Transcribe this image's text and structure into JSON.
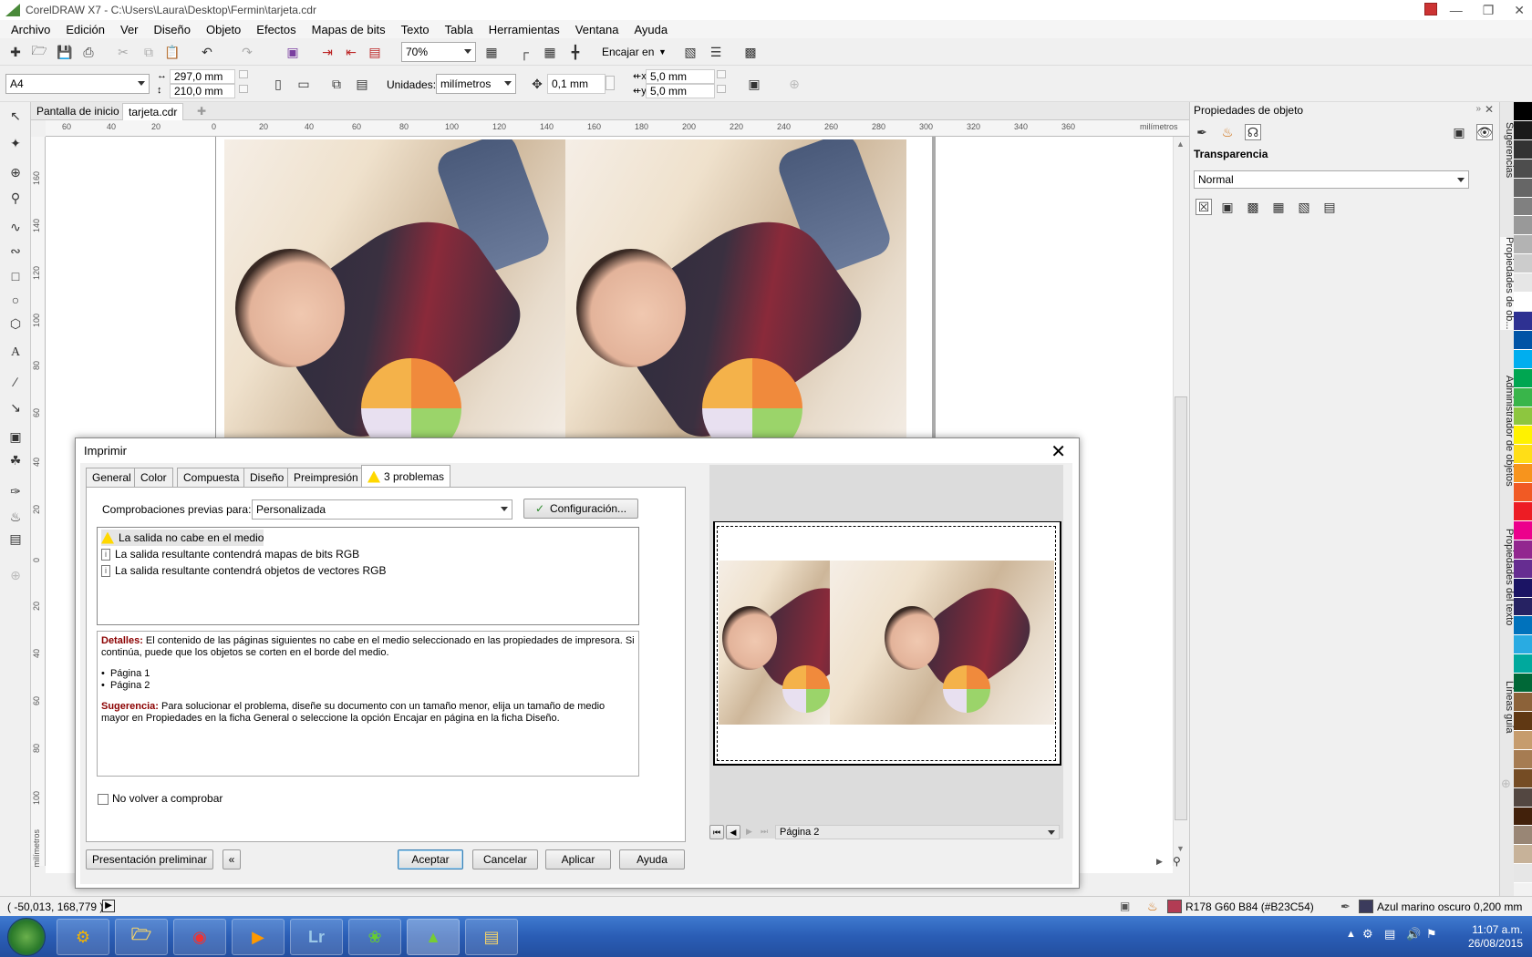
{
  "window": {
    "title": "CorelDRAW X7 - C:\\Users\\Laura\\Desktop\\Fermin\\tarjeta.cdr"
  },
  "menu": [
    "Archivo",
    "Edición",
    "Ver",
    "Diseño",
    "Objeto",
    "Efectos",
    "Mapas de bits",
    "Texto",
    "Tabla",
    "Herramientas",
    "Ventana",
    "Ayuda"
  ],
  "toolbar": {
    "zoom": "70%",
    "snap_label": "Encajar en"
  },
  "propbar": {
    "page_size": "A4",
    "width": "297,0 mm",
    "height": "210,0 mm",
    "units_label": "Unidades:",
    "units": "milímetros",
    "nudge": "0,1 mm",
    "dup_x": "5,0 mm",
    "dup_y": "5,0 mm"
  },
  "doc_tabs": [
    "Pantalla de inicio",
    "tarjeta.cdr"
  ],
  "ruler": {
    "h_ticks": [
      "60",
      "40",
      "20",
      "0",
      "20",
      "40",
      "60",
      "80",
      "100",
      "120",
      "140",
      "160",
      "180",
      "200",
      "220",
      "240",
      "260",
      "280",
      "300",
      "320",
      "340",
      "360"
    ],
    "unit": "milímetros",
    "v_ticks": [
      "160",
      "140",
      "120",
      "100",
      "80",
      "60",
      "40",
      "20",
      "0",
      "20",
      "40",
      "60",
      "80",
      "100"
    ]
  },
  "right_panel": {
    "title": "Propiedades de objeto",
    "section": "Transparencia",
    "mode": "Normal"
  },
  "side_tabs": [
    "Sugerencias",
    "Propiedades de ob...",
    "Administrador de objetos",
    "Propiedades del texto",
    "Líneas guía"
  ],
  "palette": [
    "#000000",
    "#1a1a1a",
    "#333333",
    "#4d4d4d",
    "#666666",
    "#808080",
    "#999999",
    "#b3b3b3",
    "#cccccc",
    "#e6e6e6",
    "#ffffff",
    "#2e3192",
    "#0054a6",
    "#00aeef",
    "#00a651",
    "#39b54a",
    "#8dc63f",
    "#fff200",
    "#ffde17",
    "#f7941d",
    "#f15a24",
    "#ed1c24",
    "#ec008c",
    "#92278f",
    "#662d91",
    "#1b1464",
    "#262262",
    "#0072bc",
    "#29abe2",
    "#00a99d",
    "#006837",
    "#8c6239",
    "#603813",
    "#c69c6d",
    "#a67c52",
    "#754c24",
    "#534741",
    "#42210b",
    "#998675",
    "#c7b299",
    "#e6e6e6",
    "#f2f2f2"
  ],
  "dialog": {
    "title": "Imprimir",
    "tabs": [
      "General",
      "Color",
      "Compuesta",
      "Diseño",
      "Preimpresión",
      "3 problemas"
    ],
    "preflight_label": "Comprobaciones previas para:",
    "preflight_value": "Personalizada",
    "config_button": "Configuración...",
    "issues": [
      {
        "text": "La salida no cabe en el medio",
        "type": "warning"
      },
      {
        "text": "La salida resultante contendrá mapas de bits RGB",
        "type": "info"
      },
      {
        "text": "La salida resultante contendrá objetos de vectores RGB",
        "type": "info"
      }
    ],
    "details_label": "Detalles:",
    "details_text": "El contenido de las páginas siguientes no cabe en el medio seleccionado en las propiedades de impresora. Si continúa, puede que los objetos se corten en el borde del medio.",
    "pages": [
      "Página 1",
      "Página 2"
    ],
    "suggestion_label": "Sugerencia:",
    "suggestion_text": "Para solucionar el problema, diseñe su documento con un tamaño menor, elija un tamaño de medio mayor en Propiedades en la ficha General o seleccione la opción Encajar en página en la ficha Diseño.",
    "no_check": "No volver a comprobar",
    "preview_button": "Presentación preliminar",
    "ok": "Aceptar",
    "cancel": "Cancelar",
    "apply": "Aplicar",
    "help": "Ayuda",
    "page_nav": "Página 2"
  },
  "statusbar": {
    "coords": "( -50,013, 168,779 )",
    "fill": "R178 G60 B84 (#B23C54)",
    "fill_color": "#B23C54",
    "outline": "Azul marino oscuro 0,200 mm",
    "outline_color": "#3b3b5c"
  },
  "taskbar": {
    "time": "11:07 a.m.",
    "date": "26/08/2015"
  }
}
